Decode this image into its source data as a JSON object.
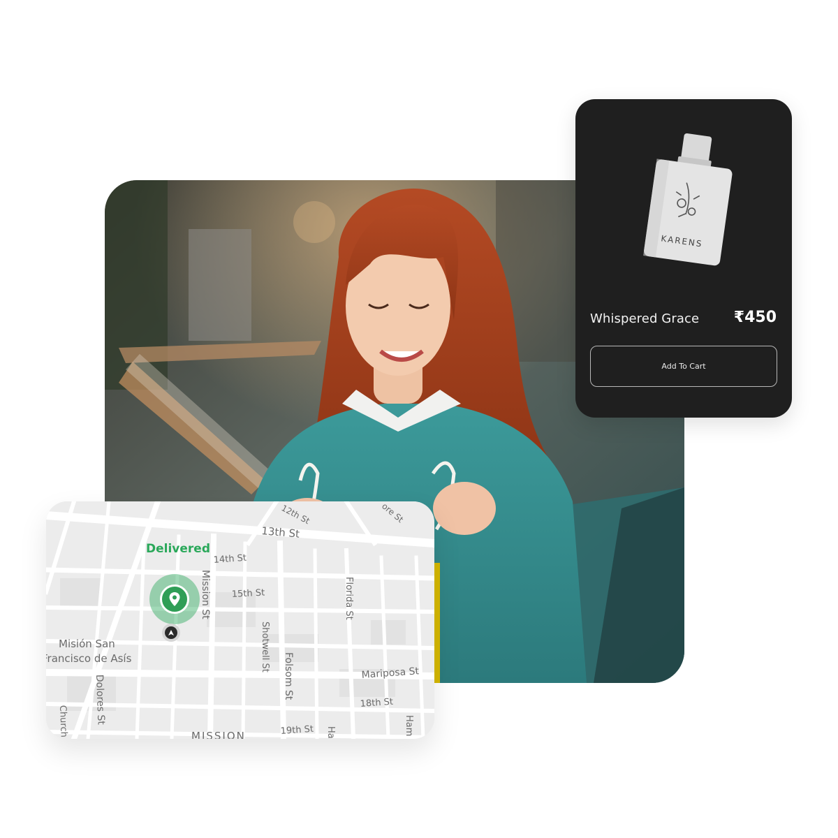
{
  "product": {
    "brand_on_bottle": "KARENS",
    "name": "Whispered Grace",
    "price": "₹450",
    "cta_label": "Add To Cart"
  },
  "map": {
    "status": "Delivered",
    "streets": {
      "s12": "12th St",
      "s13": "13th St",
      "s14": "14th St",
      "s15": "15th St",
      "mission": "Mission St",
      "shotwell": "Shotwell St",
      "folsom": "Folsom St",
      "florida": "Florida St",
      "mariposa": "Mariposa St",
      "s18": "18th St",
      "s19": "19th St",
      "dolores": "Dolores St",
      "church": "Church",
      "ham": "Ham",
      "ha": "Ha",
      "moore": "ore St",
      "mission_district": "MISSION",
      "landmark_1": "Misión San",
      "landmark_2": "Francisco de Asís"
    }
  },
  "colors": {
    "card_dark": "#1f1f1f",
    "delivered_green": "#2aa85a",
    "map_bg": "#ececec"
  },
  "icons": {
    "pin": "location-pin-icon",
    "nav": "navigation-arrow-icon"
  }
}
